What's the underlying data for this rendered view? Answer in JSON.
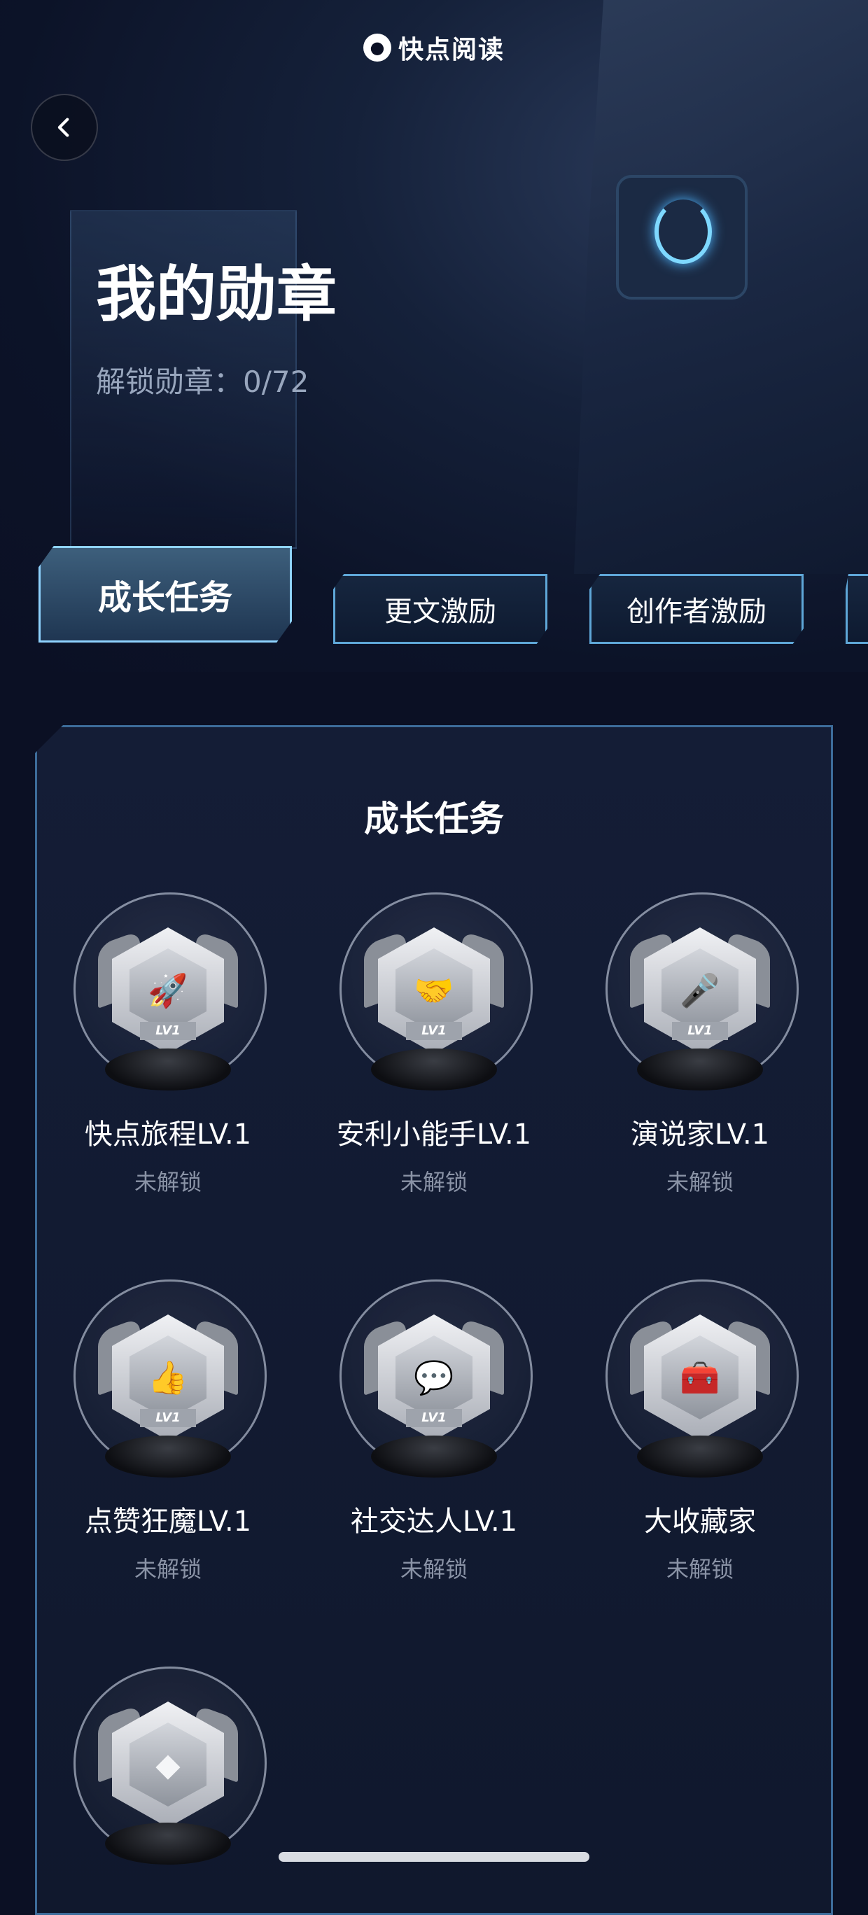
{
  "app": {
    "logo_text": "快点阅读"
  },
  "header": {
    "title": "我的勋章",
    "unlock_label": "解锁勋章：",
    "unlock_count": "0/72"
  },
  "tabs": [
    {
      "label": "成长任务",
      "active": true
    },
    {
      "label": "更文激励",
      "active": false
    },
    {
      "label": "创作者激励",
      "active": false
    }
  ],
  "panel": {
    "title": "成长任务"
  },
  "badges": [
    {
      "name": "快点旅程LV.1",
      "status": "未解锁",
      "icon": "rocket-icon",
      "level_tag": "LV1"
    },
    {
      "name": "安利小能手LV.1",
      "status": "未解锁",
      "icon": "handshake-icon",
      "level_tag": "LV1"
    },
    {
      "name": "演说家LV.1",
      "status": "未解锁",
      "icon": "microphone-icon",
      "level_tag": "LV1"
    },
    {
      "name": "点赞狂魔LV.1",
      "status": "未解锁",
      "icon": "thumbs-up-icon",
      "level_tag": "LV1"
    },
    {
      "name": "社交达人LV.1",
      "status": "未解锁",
      "icon": "chat-bubble-icon",
      "level_tag": "LV1"
    },
    {
      "name": "大收藏家",
      "status": "未解锁",
      "icon": "treasure-chest-icon",
      "level_tag": ""
    },
    {
      "name": "",
      "status": "",
      "icon": "gold-ingot-icon",
      "level_tag": ""
    }
  ],
  "colors": {
    "accent": "#8fd3ff",
    "panel_border": "#3d6c9a",
    "muted_text": "#8a93a6"
  }
}
